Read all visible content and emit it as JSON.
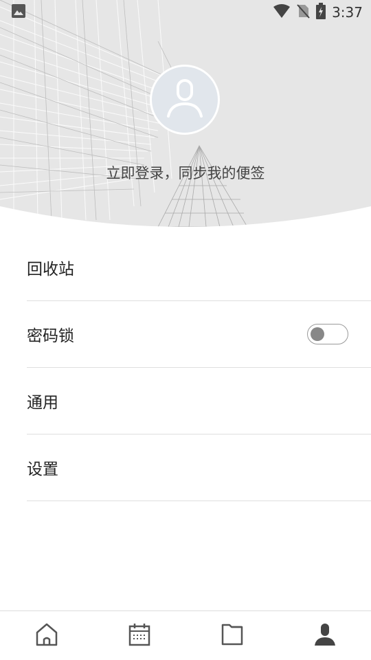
{
  "status_bar": {
    "time": "3:37",
    "icons": [
      "image-notification-icon",
      "wifi-icon",
      "no-sim-icon",
      "battery-charging-icon"
    ]
  },
  "profile": {
    "avatar_icon": "user-icon",
    "login_prompt": "立即登录，同步我的便签"
  },
  "menu": {
    "items": [
      {
        "label": "回收站"
      },
      {
        "label": "密码锁",
        "toggle_on": false
      },
      {
        "label": "通用"
      },
      {
        "label": "设置"
      }
    ]
  },
  "bottom_nav": {
    "items": [
      {
        "icon": "home-icon",
        "active": false
      },
      {
        "icon": "calendar-icon",
        "active": false
      },
      {
        "icon": "folder-icon",
        "active": false
      },
      {
        "icon": "profile-icon",
        "active": true
      }
    ]
  },
  "colors": {
    "header_bg": "#e6e6e6",
    "avatar_bg": "#e1e6ec",
    "toggle_knob": "#888888",
    "nav_icon": "#555555"
  }
}
